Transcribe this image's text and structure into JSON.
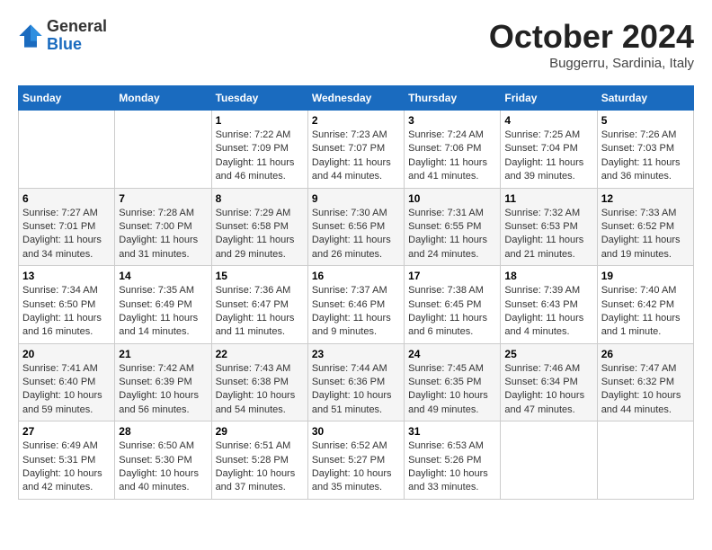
{
  "header": {
    "logo_general": "General",
    "logo_blue": "Blue",
    "month_title": "October 2024",
    "location": "Buggerru, Sardinia, Italy"
  },
  "weekdays": [
    "Sunday",
    "Monday",
    "Tuesday",
    "Wednesday",
    "Thursday",
    "Friday",
    "Saturday"
  ],
  "weeks": [
    [
      {
        "day": "",
        "sunrise": "",
        "sunset": "",
        "daylight": ""
      },
      {
        "day": "",
        "sunrise": "",
        "sunset": "",
        "daylight": ""
      },
      {
        "day": "1",
        "sunrise": "Sunrise: 7:22 AM",
        "sunset": "Sunset: 7:09 PM",
        "daylight": "Daylight: 11 hours and 46 minutes."
      },
      {
        "day": "2",
        "sunrise": "Sunrise: 7:23 AM",
        "sunset": "Sunset: 7:07 PM",
        "daylight": "Daylight: 11 hours and 44 minutes."
      },
      {
        "day": "3",
        "sunrise": "Sunrise: 7:24 AM",
        "sunset": "Sunset: 7:06 PM",
        "daylight": "Daylight: 11 hours and 41 minutes."
      },
      {
        "day": "4",
        "sunrise": "Sunrise: 7:25 AM",
        "sunset": "Sunset: 7:04 PM",
        "daylight": "Daylight: 11 hours and 39 minutes."
      },
      {
        "day": "5",
        "sunrise": "Sunrise: 7:26 AM",
        "sunset": "Sunset: 7:03 PM",
        "daylight": "Daylight: 11 hours and 36 minutes."
      }
    ],
    [
      {
        "day": "6",
        "sunrise": "Sunrise: 7:27 AM",
        "sunset": "Sunset: 7:01 PM",
        "daylight": "Daylight: 11 hours and 34 minutes."
      },
      {
        "day": "7",
        "sunrise": "Sunrise: 7:28 AM",
        "sunset": "Sunset: 7:00 PM",
        "daylight": "Daylight: 11 hours and 31 minutes."
      },
      {
        "day": "8",
        "sunrise": "Sunrise: 7:29 AM",
        "sunset": "Sunset: 6:58 PM",
        "daylight": "Daylight: 11 hours and 29 minutes."
      },
      {
        "day": "9",
        "sunrise": "Sunrise: 7:30 AM",
        "sunset": "Sunset: 6:56 PM",
        "daylight": "Daylight: 11 hours and 26 minutes."
      },
      {
        "day": "10",
        "sunrise": "Sunrise: 7:31 AM",
        "sunset": "Sunset: 6:55 PM",
        "daylight": "Daylight: 11 hours and 24 minutes."
      },
      {
        "day": "11",
        "sunrise": "Sunrise: 7:32 AM",
        "sunset": "Sunset: 6:53 PM",
        "daylight": "Daylight: 11 hours and 21 minutes."
      },
      {
        "day": "12",
        "sunrise": "Sunrise: 7:33 AM",
        "sunset": "Sunset: 6:52 PM",
        "daylight": "Daylight: 11 hours and 19 minutes."
      }
    ],
    [
      {
        "day": "13",
        "sunrise": "Sunrise: 7:34 AM",
        "sunset": "Sunset: 6:50 PM",
        "daylight": "Daylight: 11 hours and 16 minutes."
      },
      {
        "day": "14",
        "sunrise": "Sunrise: 7:35 AM",
        "sunset": "Sunset: 6:49 PM",
        "daylight": "Daylight: 11 hours and 14 minutes."
      },
      {
        "day": "15",
        "sunrise": "Sunrise: 7:36 AM",
        "sunset": "Sunset: 6:47 PM",
        "daylight": "Daylight: 11 hours and 11 minutes."
      },
      {
        "day": "16",
        "sunrise": "Sunrise: 7:37 AM",
        "sunset": "Sunset: 6:46 PM",
        "daylight": "Daylight: 11 hours and 9 minutes."
      },
      {
        "day": "17",
        "sunrise": "Sunrise: 7:38 AM",
        "sunset": "Sunset: 6:45 PM",
        "daylight": "Daylight: 11 hours and 6 minutes."
      },
      {
        "day": "18",
        "sunrise": "Sunrise: 7:39 AM",
        "sunset": "Sunset: 6:43 PM",
        "daylight": "Daylight: 11 hours and 4 minutes."
      },
      {
        "day": "19",
        "sunrise": "Sunrise: 7:40 AM",
        "sunset": "Sunset: 6:42 PM",
        "daylight": "Daylight: 11 hours and 1 minute."
      }
    ],
    [
      {
        "day": "20",
        "sunrise": "Sunrise: 7:41 AM",
        "sunset": "Sunset: 6:40 PM",
        "daylight": "Daylight: 10 hours and 59 minutes."
      },
      {
        "day": "21",
        "sunrise": "Sunrise: 7:42 AM",
        "sunset": "Sunset: 6:39 PM",
        "daylight": "Daylight: 10 hours and 56 minutes."
      },
      {
        "day": "22",
        "sunrise": "Sunrise: 7:43 AM",
        "sunset": "Sunset: 6:38 PM",
        "daylight": "Daylight: 10 hours and 54 minutes."
      },
      {
        "day": "23",
        "sunrise": "Sunrise: 7:44 AM",
        "sunset": "Sunset: 6:36 PM",
        "daylight": "Daylight: 10 hours and 51 minutes."
      },
      {
        "day": "24",
        "sunrise": "Sunrise: 7:45 AM",
        "sunset": "Sunset: 6:35 PM",
        "daylight": "Daylight: 10 hours and 49 minutes."
      },
      {
        "day": "25",
        "sunrise": "Sunrise: 7:46 AM",
        "sunset": "Sunset: 6:34 PM",
        "daylight": "Daylight: 10 hours and 47 minutes."
      },
      {
        "day": "26",
        "sunrise": "Sunrise: 7:47 AM",
        "sunset": "Sunset: 6:32 PM",
        "daylight": "Daylight: 10 hours and 44 minutes."
      }
    ],
    [
      {
        "day": "27",
        "sunrise": "Sunrise: 6:49 AM",
        "sunset": "Sunset: 5:31 PM",
        "daylight": "Daylight: 10 hours and 42 minutes."
      },
      {
        "day": "28",
        "sunrise": "Sunrise: 6:50 AM",
        "sunset": "Sunset: 5:30 PM",
        "daylight": "Daylight: 10 hours and 40 minutes."
      },
      {
        "day": "29",
        "sunrise": "Sunrise: 6:51 AM",
        "sunset": "Sunset: 5:28 PM",
        "daylight": "Daylight: 10 hours and 37 minutes."
      },
      {
        "day": "30",
        "sunrise": "Sunrise: 6:52 AM",
        "sunset": "Sunset: 5:27 PM",
        "daylight": "Daylight: 10 hours and 35 minutes."
      },
      {
        "day": "31",
        "sunrise": "Sunrise: 6:53 AM",
        "sunset": "Sunset: 5:26 PM",
        "daylight": "Daylight: 10 hours and 33 minutes."
      },
      {
        "day": "",
        "sunrise": "",
        "sunset": "",
        "daylight": ""
      },
      {
        "day": "",
        "sunrise": "",
        "sunset": "",
        "daylight": ""
      }
    ]
  ]
}
